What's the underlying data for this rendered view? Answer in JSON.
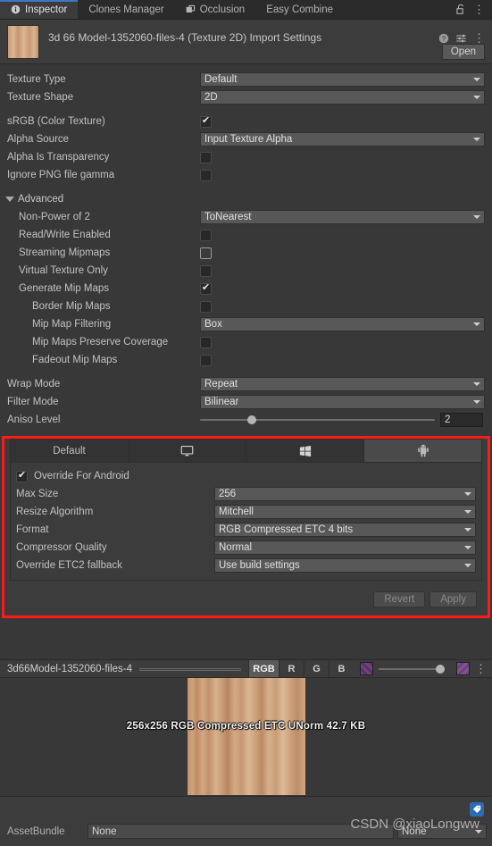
{
  "window": {
    "tabs": [
      {
        "label": "Inspector",
        "icon": "info-icon",
        "active": true
      },
      {
        "label": "Clones Manager",
        "icon": "",
        "active": false
      },
      {
        "label": "Occlusion",
        "icon": "occlusion-icon",
        "active": false
      },
      {
        "label": "Easy Combine",
        "icon": "",
        "active": false
      }
    ],
    "lock_icon": "lock-open-icon",
    "menu_icon": "kebab-menu-icon"
  },
  "asset_header": {
    "title": "3d 66 Model-1352060-files-4 (Texture 2D) Import Settings",
    "help_icon": "help-icon",
    "preset_icon": "preset-sliders-icon",
    "menu_icon": "kebab-menu-icon",
    "open_label": "Open"
  },
  "properties": {
    "texture_type": {
      "label": "Texture Type",
      "value": "Default"
    },
    "texture_shape": {
      "label": "Texture Shape",
      "value": "2D"
    },
    "srgb": {
      "label": "sRGB (Color Texture)",
      "checked": true
    },
    "alpha_source": {
      "label": "Alpha Source",
      "value": "Input Texture Alpha"
    },
    "alpha_is_transparency": {
      "label": "Alpha Is Transparency",
      "checked": false
    },
    "ignore_png_gamma": {
      "label": "Ignore PNG file gamma",
      "checked": false
    }
  },
  "advanced": {
    "label": "Advanced",
    "expanded": true,
    "non_power_of_2": {
      "label": "Non-Power of 2",
      "value": "ToNearest"
    },
    "read_write": {
      "label": "Read/Write Enabled",
      "checked": false
    },
    "streaming_mipmaps": {
      "label": "Streaming Mipmaps",
      "checked": false
    },
    "virtual_texture_only": {
      "label": "Virtual Texture Only",
      "checked": false
    },
    "generate_mip_maps": {
      "label": "Generate Mip Maps",
      "checked": true
    },
    "border_mip_maps": {
      "label": "Border Mip Maps",
      "checked": false
    },
    "mip_map_filtering": {
      "label": "Mip Map Filtering",
      "value": "Box"
    },
    "mip_preserve_coverage": {
      "label": "Mip Maps Preserve Coverage",
      "checked": false
    },
    "fadeout_mip_maps": {
      "label": "Fadeout Mip Maps",
      "checked": false
    }
  },
  "common": {
    "wrap_mode": {
      "label": "Wrap Mode",
      "value": "Repeat"
    },
    "filter_mode": {
      "label": "Filter Mode",
      "value": "Bilinear"
    },
    "aniso_level": {
      "label": "Aniso Level",
      "value": "2"
    }
  },
  "platform_override": {
    "highlight_color": "#ff1a1a",
    "tabs": [
      {
        "label": "Default",
        "icon": "",
        "active": false
      },
      {
        "label": "",
        "icon": "monitor-icon",
        "active": false
      },
      {
        "label": "",
        "icon": "windows-icon",
        "active": false
      },
      {
        "label": "",
        "icon": "android-icon",
        "active": true
      }
    ],
    "override_checkbox": {
      "label": "Override For Android",
      "checked": true
    },
    "rows": [
      {
        "label": "Max Size",
        "value": "256"
      },
      {
        "label": "Resize Algorithm",
        "value": "Mitchell"
      },
      {
        "label": "Format",
        "value": "RGB Compressed ETC 4 bits"
      },
      {
        "label": "Compressor Quality",
        "value": "Normal"
      },
      {
        "label": "Override ETC2 fallback",
        "value": "Use build settings"
      }
    ],
    "revert_label": "Revert",
    "apply_label": "Apply"
  },
  "preview": {
    "name": "3d66Model-1352060-files-4",
    "channels": [
      "RGB",
      "R",
      "G",
      "B"
    ],
    "active_channel": "RGB",
    "mip_low_icon": "mip-low-icon",
    "mip_high_icon": "mip-high-icon",
    "menu_icon": "kebab-menu-icon",
    "info": "256x256  RGB Compressed ETC UNorm   42.7 KB"
  },
  "bottom": {
    "tag_icon": "tag-icon",
    "assetbundle_label": "AssetBundle",
    "assetbundle_value": "None",
    "variant_value": "None",
    "watermark": "CSDN @xiaoLongww"
  }
}
